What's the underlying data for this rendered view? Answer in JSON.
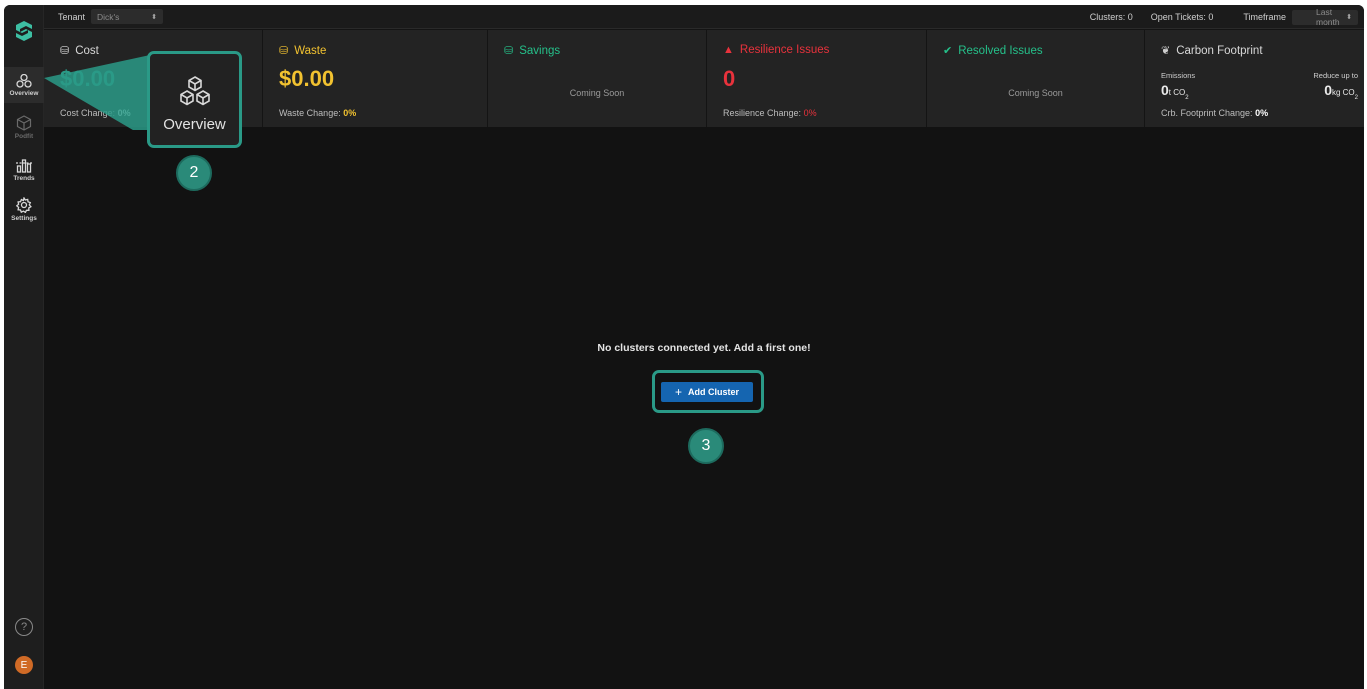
{
  "sidebar": {
    "items": [
      {
        "label": "Overview",
        "icon": "overview-icon"
      },
      {
        "label": "Podfit",
        "icon": "podfit-icon"
      },
      {
        "label": "Trends",
        "icon": "trends-icon"
      },
      {
        "label": "Settings",
        "icon": "settings-icon"
      }
    ],
    "help_symbol": "?",
    "avatar_initial": "E"
  },
  "topbar": {
    "tenant_label": "Tenant",
    "tenant_value": "Dick's",
    "clusters": "Clusters: 0",
    "open_tickets": "Open Tickets: 0",
    "timeframe_label": "Timeframe",
    "timeframe_value": "Last month"
  },
  "cards": {
    "cost": {
      "title": "Cost",
      "value": "$0.00",
      "change_label": "Cost Change:",
      "change_value": "0%"
    },
    "waste": {
      "title": "Waste",
      "value": "$0.00",
      "change_label": "Waste Change:",
      "change_value": "0%"
    },
    "savings": {
      "title": "Savings",
      "status": "Coming Soon"
    },
    "resilience": {
      "title": "Resilience Issues",
      "value": "0",
      "change_label": "Resilience Change:",
      "change_value": "0%"
    },
    "resolved": {
      "title": "Resolved Issues",
      "status": "Coming Soon"
    },
    "carbon": {
      "title": "Carbon Footprint",
      "emissions_label": "Emissions",
      "emissions_value": "0",
      "emissions_unit": "t CO",
      "emissions_sub": "2",
      "reduce_label": "Reduce up to",
      "reduce_value": "0",
      "reduce_unit": "kg CO",
      "reduce_sub": "2",
      "change_label": "Crb. Footprint Change:",
      "change_value": "0%"
    }
  },
  "main": {
    "empty_message": "No clusters connected yet. Add a first one!",
    "add_button": "Add Cluster",
    "add_button_symbol": "+"
  },
  "annotations": {
    "zoom_label": "Overview",
    "step_2": "2",
    "step_3": "3"
  },
  "colors": {
    "accent_teal": "#2a9a87",
    "waste_yellow": "#f2c230",
    "savings_green": "#25c08a",
    "resilience_red": "#e8323c",
    "button_blue": "#1565b0",
    "avatar_orange": "#d06a26"
  }
}
